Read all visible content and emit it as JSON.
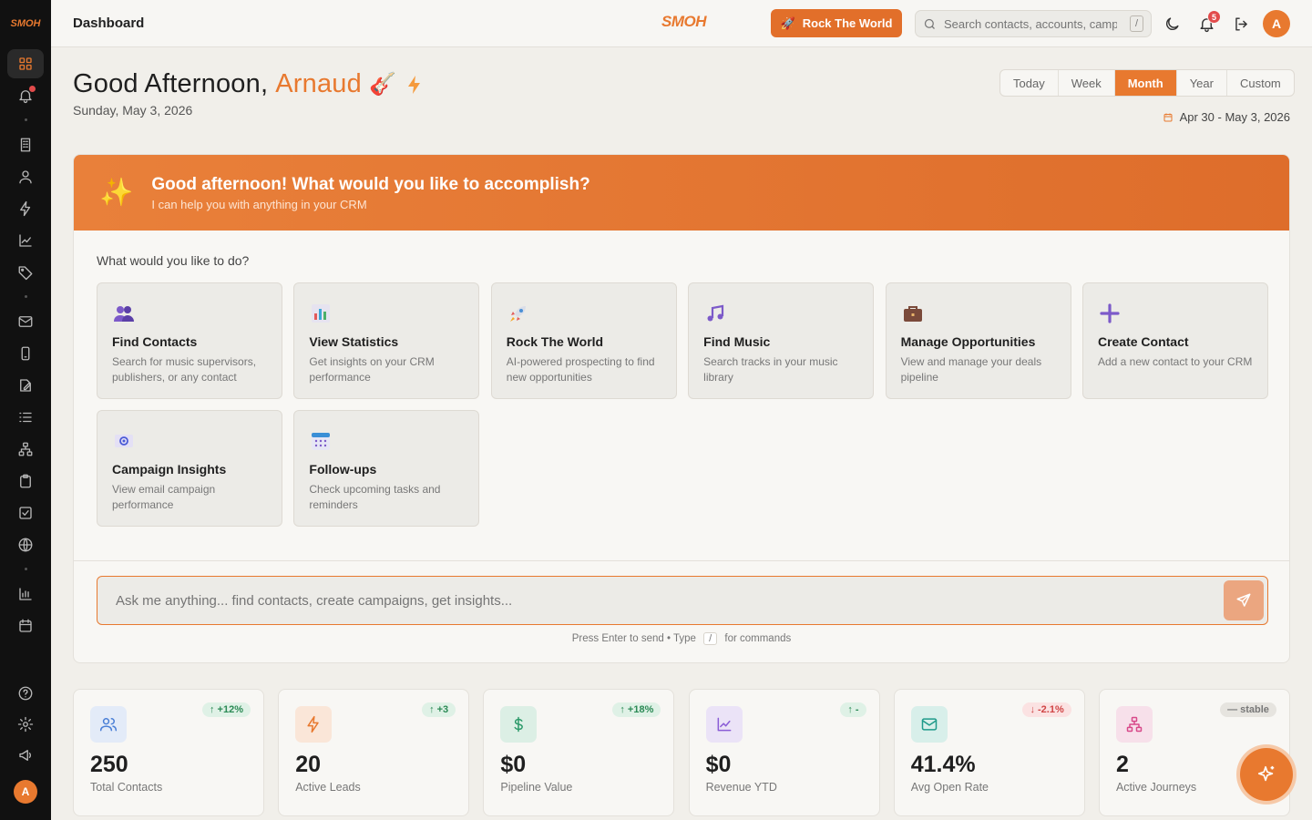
{
  "sidebar": {
    "logo": "SMOH",
    "avatar": "A",
    "groups": [
      [
        "grid-icon",
        "bell-icon"
      ],
      [
        "building-icon",
        "user-icon",
        "bolt-icon",
        "trend-icon",
        "tag-icon"
      ],
      [
        "mail-icon",
        "phone-icon",
        "edit-icon",
        "list-icon",
        "hierarchy-icon",
        "clipboard-icon",
        "check-square-icon",
        "globe-icon"
      ],
      [
        "bar-chart-icon",
        "calendar-icon"
      ]
    ],
    "bottom": [
      "help-icon",
      "settings-icon",
      "megaphone-icon"
    ]
  },
  "topbar": {
    "title": "Dashboard",
    "logo": "SMOH",
    "rock_button": "Rock The World",
    "search_placeholder": "Search contacts, accounts, campaigns...",
    "search_shortcut": "/",
    "notification_count": "5",
    "avatar": "A"
  },
  "greeting": {
    "prefix": "Good Afternoon,",
    "name": "Arnaud",
    "date": "Sunday, May 3, 2026"
  },
  "range": {
    "options": [
      "Today",
      "Week",
      "Month",
      "Year",
      "Custom"
    ],
    "active": "Month",
    "date_range": "Apr 30 - May 3, 2026"
  },
  "assistant": {
    "title": "Good afternoon! What would you like to accomplish?",
    "subtitle": "I can help you with anything in your CRM",
    "question": "What would you like to do?",
    "actions": [
      {
        "title": "Find Contacts",
        "desc": "Search for music supervisors, publishers, or any contact",
        "icon": "people-icon"
      },
      {
        "title": "View Statistics",
        "desc": "Get insights on your CRM performance",
        "icon": "stats-icon"
      },
      {
        "title": "Rock The World",
        "desc": "AI-powered prospecting to find new opportunities",
        "icon": "rocket-icon"
      },
      {
        "title": "Find Music",
        "desc": "Search tracks in your music library",
        "icon": "music-note-icon"
      },
      {
        "title": "Manage Opportunities",
        "desc": "View and manage your deals pipeline",
        "icon": "briefcase-icon"
      },
      {
        "title": "Create Contact",
        "desc": "Add a new contact to your CRM",
        "icon": "plus-icon"
      },
      {
        "title": "Campaign Insights",
        "desc": "View email campaign performance",
        "icon": "email-at-icon"
      },
      {
        "title": "Follow-ups",
        "desc": "Check upcoming tasks and reminders",
        "icon": "calendar-grid-icon"
      }
    ],
    "input_placeholder": "Ask me anything... find contacts, create campaigns, get insights...",
    "hint_before": "Press Enter to send • Type",
    "hint_key": "/",
    "hint_after": "for commands"
  },
  "stats": [
    {
      "value": "250",
      "label": "Total Contacts",
      "change": "+12%",
      "trend": "up",
      "icon": "users-icon",
      "color": "#4a7fd6",
      "bg": "#e3ebf8"
    },
    {
      "value": "20",
      "label": "Active Leads",
      "change": "+3",
      "trend": "up",
      "icon": "bolt-icon",
      "color": "#e8792f",
      "bg": "#fae6d8"
    },
    {
      "value": "$0",
      "label": "Pipeline Value",
      "change": "+18%",
      "trend": "up",
      "icon": "dollar-icon",
      "color": "#2c9a6a",
      "bg": "#dcefe5"
    },
    {
      "value": "$0",
      "label": "Revenue YTD",
      "change": "-",
      "trend": "up",
      "icon": "trend-icon",
      "color": "#8a5cd6",
      "bg": "#ebe3f7"
    },
    {
      "value": "41.4%",
      "label": "Avg Open Rate",
      "change": "-2.1%",
      "trend": "down",
      "icon": "mail-icon",
      "color": "#1f9a8a",
      "bg": "#d8efea"
    },
    {
      "value": "2",
      "label": "Active Journeys",
      "change": "stable",
      "trend": "flat",
      "icon": "hierarchy-icon",
      "color": "#d84a8a",
      "bg": "#f7e0ea"
    }
  ]
}
